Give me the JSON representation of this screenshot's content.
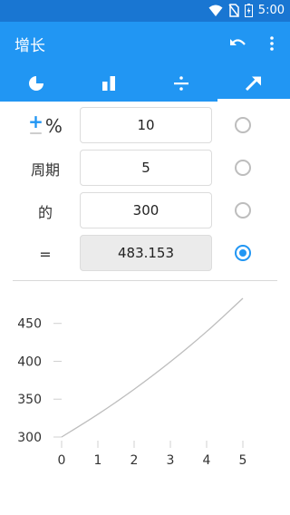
{
  "status_bar": {
    "time": "5:00",
    "icons": [
      "wifi-icon",
      "no-sim-icon",
      "battery-charging-icon"
    ]
  },
  "app_bar": {
    "title": "增长",
    "icons": [
      "undo-icon",
      "more-vert-icon"
    ]
  },
  "tabs": [
    {
      "icon": "pie-chart-icon",
      "selected": false
    },
    {
      "icon": "bar-chart-icon",
      "selected": false
    },
    {
      "icon": "divide-icon",
      "selected": false
    },
    {
      "icon": "trending-up-icon",
      "selected": true
    }
  ],
  "form": {
    "percent": {
      "label": "%",
      "value": "10",
      "selected": false
    },
    "periods": {
      "label": "周期",
      "value": "5",
      "selected": false
    },
    "of": {
      "label": "的",
      "value": "300",
      "selected": false
    },
    "result": {
      "label": "=",
      "value": "483.153",
      "selected": true
    }
  },
  "chart_data": {
    "type": "line",
    "x": [
      0,
      1,
      2,
      3,
      4,
      5
    ],
    "y": [
      300,
      330,
      363,
      399.3,
      439.23,
      483.153
    ],
    "xticks": [
      "0",
      "1",
      "2",
      "3",
      "4",
      "5"
    ],
    "yticks": [
      "300",
      "350",
      "400",
      "450"
    ],
    "xlim": [
      0,
      5
    ],
    "ylim": [
      300,
      483.153
    ],
    "line_color": "#bdbdbd",
    "title": "",
    "xlabel": "",
    "ylabel": ""
  },
  "colors": {
    "primary": "#2196f3",
    "primary_dark": "#1976d2",
    "accent": "#2196f3"
  }
}
